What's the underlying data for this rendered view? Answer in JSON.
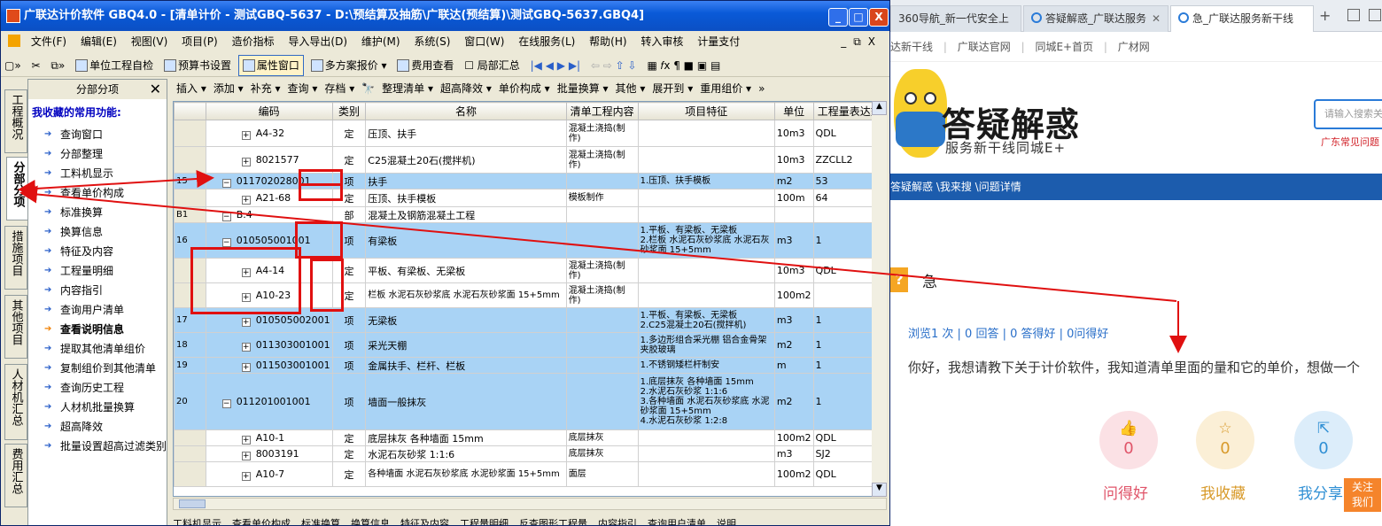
{
  "browser": {
    "tabs": [
      "360导航_新一代安全上",
      "答疑解惑_广联达服务",
      "急_广联达服务新干线"
    ],
    "new_tab": "+",
    "links": [
      "达新干线",
      "|",
      "广联达官网",
      "|",
      "同城E+首页",
      "|",
      "广材网"
    ],
    "brand": "答疑解惑",
    "slogan": "服务新干线同城E+",
    "search_placeholder": "请输入搜索关",
    "hot_question": "广东常见问题",
    "breadcrumb": "答疑解惑 \\我来搜 \\问题详情",
    "question_icon": "?",
    "question_title": "急",
    "stats": "浏览1 次 | 0 回答 | 0 答得好 | 0问得好",
    "question_text": "你好，我想请教下关于计价软件，我知道清单里面的量和它的单价，想做一个",
    "actions": [
      {
        "icon": "thumb-up-icon",
        "glyph": "👍",
        "count": "0",
        "label": "问得好",
        "color": "#e0556a",
        "bg": "#fbe1e5"
      },
      {
        "icon": "star-icon",
        "glyph": "☆",
        "count": "0",
        "label": "我收藏",
        "color": "#d89a2a",
        "bg": "#fbefd6"
      },
      {
        "icon": "share-icon",
        "glyph": "⇱",
        "count": "0",
        "label": "我分享",
        "color": "#2f8fd4",
        "bg": "#dcedfa"
      }
    ],
    "follow": "关注\n我们"
  },
  "app": {
    "title": "广联达计价软件 GBQ4.0 - [清单计价 - 测试GBQ-5637 - D:\\预结算及抽筋\\广联达(预结算)\\测试GBQ-5637.GBQ4]",
    "window_buttons": [
      "_",
      "□",
      "X"
    ],
    "menu": [
      "文件(F)",
      "编辑(E)",
      "视图(V)",
      "项目(P)",
      "造价指标",
      "导入导出(D)",
      "维护(M)",
      "系统(S)",
      "窗口(W)",
      "在线服务(L)",
      "帮助(H)",
      "转入审核",
      "计量支付"
    ],
    "mdi_buttons": [
      "_",
      "⧉",
      "X"
    ],
    "toolbar": [
      "单位工程自检",
      "预算书设置",
      "属性窗口",
      "多方案报价",
      "费用查看",
      "局部汇总"
    ],
    "vtabs": [
      "工程概况",
      "分部分项",
      "措施项目",
      "其他项目",
      "人材机汇总",
      "费用汇总"
    ],
    "side_panel": {
      "title": "分部分项",
      "close": "✕",
      "fav_heading": "我收藏的常用功能:",
      "items": [
        "查询窗口",
        "分部整理",
        "工料机显示",
        "查看单价构成",
        "标准换算",
        "换算信息",
        "特征及内容",
        "工程量明细",
        "内容指引",
        "查询用户清单",
        "查看说明信息",
        "提取其他清单组价",
        "复制组价到其他清单",
        "查询历史工程",
        "人材机批量换算",
        "超高降效",
        "批量设置超高过滤类别"
      ]
    },
    "toolbar2": [
      "插入 ▾",
      "添加 ▾",
      "补充 ▾",
      "查询 ▾",
      "存档 ▾",
      "🔭",
      "整理清单 ▾",
      "超高降效 ▾",
      "单价构成 ▾",
      "批量换算 ▾",
      "其他 ▾",
      "展开到 ▾",
      "重用组价 ▾",
      "»"
    ],
    "columns": [
      "",
      "编码",
      "类别",
      "名称",
      "清单工程内容",
      "项目特征",
      "单位",
      "工程量表达式"
    ],
    "rows": [
      {
        "num": "",
        "tree": "+",
        "code": "A4-32",
        "type": "定",
        "name": "压顶、扶手",
        "content": "混凝土浇捣(制作)",
        "feature": "",
        "unit": "10m3",
        "expr": "QDL",
        "hl": false,
        "h": 30
      },
      {
        "num": "",
        "tree": "+",
        "code": "8021577",
        "type": "定",
        "name": "C25混凝土20石(搅拌机)",
        "content": "混凝土浇捣(制作)",
        "feature": "",
        "unit": "10m3",
        "expr": "ZZCLL2",
        "hl": false,
        "h": 30
      },
      {
        "num": "15",
        "tree": "−",
        "code": "011702028001",
        "type": "项",
        "name": "扶手",
        "content": "",
        "feature": "1.压顶、扶手模板",
        "unit": "m2",
        "expr": "53",
        "hl": true,
        "h": 18
      },
      {
        "num": "",
        "tree": "+",
        "code": "A21-68",
        "type": "定",
        "name": "压顶、扶手模板",
        "content": "模板制作",
        "feature": "",
        "unit": "100m",
        "expr": "64",
        "hl": false,
        "h": 20
      },
      {
        "num": "B1",
        "tree": "−",
        "code": "B.4",
        "type": "部",
        "name": "混凝土及钢筋混凝土工程",
        "content": "",
        "feature": "",
        "unit": "",
        "expr": "",
        "hl": false,
        "h": 18
      },
      {
        "num": "16",
        "tree": "−",
        "code": "010505001001",
        "type": "项",
        "name": "有梁板",
        "content": "",
        "feature": "1.平板、有梁板、无梁板\n2.栏板 水泥石灰砂浆底 水泥石灰砂浆面 15+5mm",
        "unit": "m3",
        "expr": "1",
        "hl": true,
        "h": 40
      },
      {
        "num": "",
        "tree": "+",
        "code": "A4-14",
        "type": "定",
        "name": "平板、有梁板、无梁板",
        "content": "混凝土浇捣(制作)",
        "feature": "",
        "unit": "10m3",
        "expr": "QDL",
        "hl": false,
        "h": 28
      },
      {
        "num": "",
        "tree": "+",
        "code": "A10-23",
        "type": "定",
        "name": "栏板 水泥石灰砂浆底 水泥石灰砂浆面 15+5mm",
        "content": "混凝土浇捣(制作)",
        "feature": "",
        "unit": "100m2",
        "expr": "",
        "hl": false,
        "h": 28
      },
      {
        "num": "17",
        "tree": "+",
        "code": "010505002001",
        "type": "项",
        "name": "无梁板",
        "content": "",
        "feature": "1.平板、有梁板、无梁板\n2.C25混凝土20石(搅拌机)",
        "unit": "m3",
        "expr": "1",
        "hl": true,
        "h": 28
      },
      {
        "num": "18",
        "tree": "+",
        "code": "011303001001",
        "type": "项",
        "name": "采光天棚",
        "content": "",
        "feature": "1.多边形组合采光棚 铝合金骨架夹胶玻璃",
        "unit": "m2",
        "expr": "1",
        "hl": true,
        "h": 28
      },
      {
        "num": "19",
        "tree": "+",
        "code": "011503001001",
        "type": "项",
        "name": "金属扶手、栏杆、栏板",
        "content": "",
        "feature": "1.不锈钢矮栏杆制安",
        "unit": "m",
        "expr": "1",
        "hl": true,
        "h": 18
      },
      {
        "num": "20",
        "tree": "−",
        "code": "011201001001",
        "type": "项",
        "name": "墙面一般抹灰",
        "content": "",
        "feature": "1.底层抹灰 各种墙面 15mm\n2.水泥石灰砂浆 1:1:6\n3.各种墙面 水泥石灰砂浆底 水泥砂浆面 15+5mm\n4.水泥石灰砂浆 1:2:8",
        "unit": "m2",
        "expr": "1",
        "hl": true,
        "h": 64
      },
      {
        "num": "",
        "tree": "+",
        "code": "A10-1",
        "type": "定",
        "name": "底层抹灰 各种墙面 15mm",
        "content": "底层抹灰",
        "feature": "",
        "unit": "100m2",
        "expr": "QDL",
        "hl": false,
        "h": 18
      },
      {
        "num": "",
        "tree": "+",
        "code": "8003191",
        "type": "定",
        "name": "水泥石灰砂浆 1:1:6",
        "content": "底层抹灰",
        "feature": "",
        "unit": "m3",
        "expr": "SJ2",
        "hl": false,
        "h": 18
      },
      {
        "num": "",
        "tree": "+",
        "code": "A10-7",
        "type": "定",
        "name": "各种墙面 水泥石灰砂浆底 水泥砂浆面 15+5mm",
        "content": "面层",
        "feature": "",
        "unit": "100m2",
        "expr": "QDL",
        "hl": false,
        "h": 28
      }
    ],
    "bottom_tabs": [
      "工料机显示",
      "查看单价构成",
      "标准换算",
      "换算信息",
      "特征及内容",
      "工程量明细",
      "反查图形工程量",
      "内容指引",
      "查询用户清单",
      "说明"
    ]
  },
  "colors": {
    "annotation": "#e01010",
    "row_highlight": "#a9d3f5",
    "brand_blue": "#1c5cad"
  }
}
